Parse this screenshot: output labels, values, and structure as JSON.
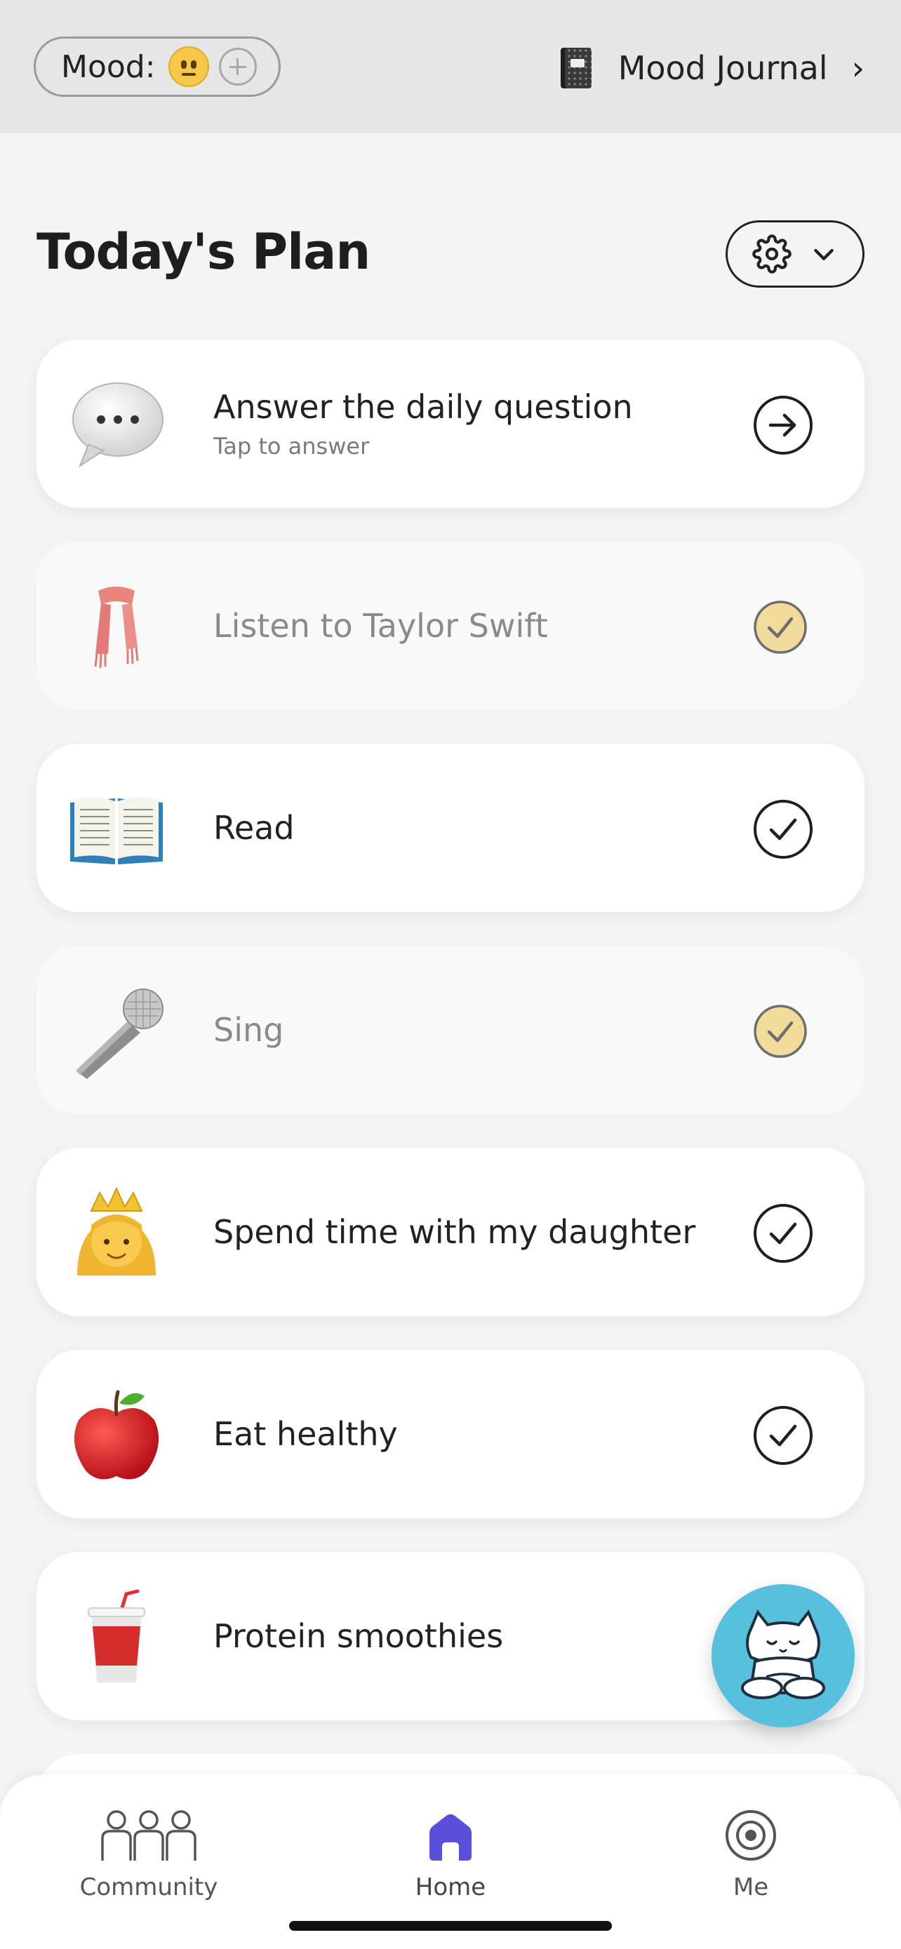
{
  "topbar": {
    "mood_label": "Mood:",
    "mood_icon": "neutral-face-emoji",
    "mood_add_icon": "plus-circle-icon",
    "journal_label": "Mood Journal",
    "journal_icon": "notebook-icon",
    "journal_chevron": "›"
  },
  "header": {
    "title": "Today's Plan",
    "settings_icon": "gear-icon",
    "dropdown_icon": "chevron-down-icon"
  },
  "tasks": [
    {
      "label": "Answer the daily question",
      "sub": "Tap to answer",
      "icon": "speech-bubble-emoji",
      "state": "arrow"
    },
    {
      "label": "Listen to Taylor Swift",
      "sub": "",
      "icon": "scarf-emoji",
      "state": "done"
    },
    {
      "label": "Read",
      "sub": "",
      "icon": "open-book-emoji",
      "state": "todo"
    },
    {
      "label": "Sing",
      "sub": "",
      "icon": "microphone-emoji",
      "state": "done"
    },
    {
      "label": "Spend time with my daughter",
      "sub": "",
      "icon": "princess-emoji",
      "state": "todo"
    },
    {
      "label": "Eat healthy",
      "sub": "",
      "icon": "red-apple-emoji",
      "state": "todo"
    },
    {
      "label": "Protein smoothies",
      "sub": "",
      "icon": "cup-with-straw-emoji",
      "state": "todo"
    }
  ],
  "fab": {
    "icon": "meditating-cat-icon"
  },
  "nav": {
    "items": [
      {
        "label": "Community",
        "icon": "community-icon"
      },
      {
        "label": "Home",
        "icon": "home-icon",
        "active": true
      },
      {
        "label": "Me",
        "icon": "target-icon"
      }
    ]
  },
  "colors": {
    "accent": "#5a4fd8",
    "done_check": "#f2dc9c",
    "fab": "#56c0dd",
    "background": "#f4f4f4"
  }
}
